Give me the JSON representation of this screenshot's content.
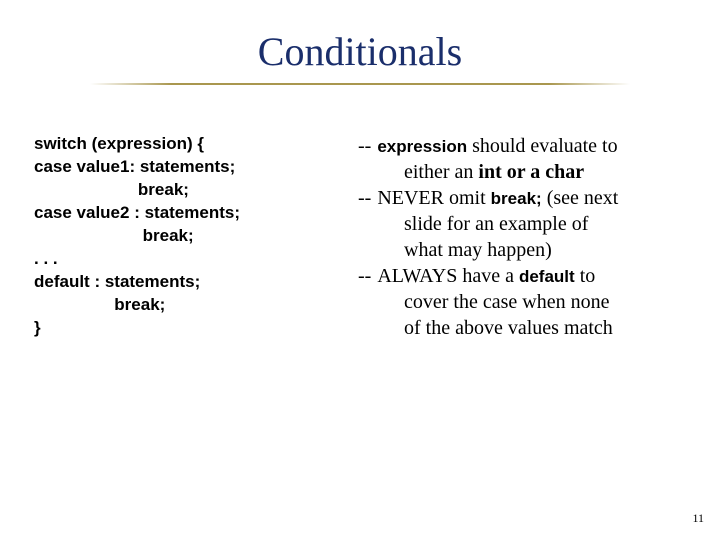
{
  "title": "Conditionals",
  "code": {
    "l1": "switch (expression) {",
    "l2": "case value1: statements;",
    "l3": "                      break;",
    "l4": "case value2 : statements;",
    "l5": "                       break;",
    "l6": ". . .",
    "l7": "default : statements;",
    "l8": "                 break;",
    "l9": "}"
  },
  "notes": {
    "dash": "--",
    "n1_kw": "expression",
    "n1_a": " should evaluate to",
    "n1_b": "either an ",
    "n1_b2": "int or a char",
    "n2_a": "NEVER omit ",
    "n2_kw": "break;",
    "n2_b": " (see next",
    "n2_c": "slide for an example of",
    "n2_d": "what may happen)",
    "n3_a": "ALWAYS have a ",
    "n3_kw": "default",
    "n3_b": " to",
    "n3_c": "cover the case when none",
    "n3_d": "of the above values match"
  },
  "page": "11"
}
